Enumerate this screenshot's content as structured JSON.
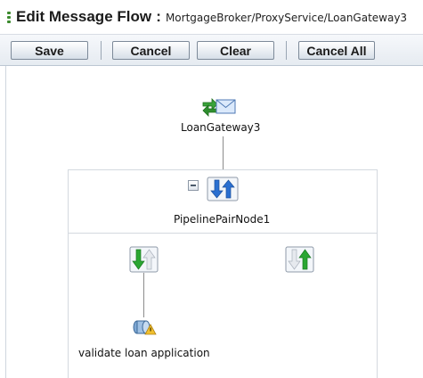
{
  "header": {
    "title": "Edit Message Flow",
    "separator": ":",
    "path": "MortgageBroker/ProxyService/LoanGateway3"
  },
  "toolbar": {
    "save_label": "Save",
    "cancel_label": "Cancel",
    "clear_label": "Clear",
    "cancel_all_label": "Cancel All"
  },
  "flow": {
    "proxy_node": {
      "label": "LoanGateway3",
      "icon": "proxy-service-envelope-icon"
    },
    "pipeline_pair": {
      "label": "PipelinePairNode1",
      "icon": "pipeline-pair-icon"
    },
    "request_pipeline": {
      "icon": "request-pipeline-icon"
    },
    "response_pipeline": {
      "icon": "response-pipeline-icon"
    },
    "stage": {
      "label": "validate loan application",
      "icon": "stage-icon"
    }
  },
  "colors": {
    "button_border": "#7d8a99",
    "pipeline_blue": "#2a6fd0",
    "pipeline_green": "#2aa632",
    "panel_border": "#d4d9df"
  }
}
